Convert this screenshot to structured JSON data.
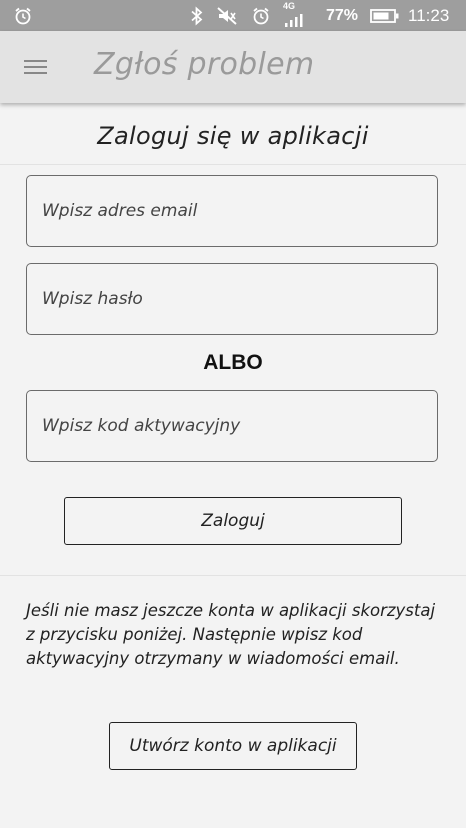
{
  "status_bar": {
    "icons": [
      "alarm-icon",
      "bluetooth-icon",
      "vibrate-off-icon",
      "alarm-icon",
      "network-4g-signal-icon",
      "battery-icon"
    ],
    "network": "4G",
    "battery": "77%",
    "time": "11:23"
  },
  "toolbar": {
    "menu_icon": "hamburger-menu-icon",
    "title": "Zgłoś problem"
  },
  "login": {
    "heading": "Zaloguj się w aplikacji",
    "email_placeholder": "Wpisz adres email",
    "password_placeholder": "Wpisz hasło",
    "or_label": "ALBO",
    "activation_placeholder": "Wpisz kod aktywacyjny",
    "login_button": "Zaloguj"
  },
  "register": {
    "info_text": "Jeśli nie masz jeszcze konta w aplikacji skorzystaj z przycisku poniżej. Następnie wpisz kod aktywacyjny otrzymany w wiadomości email.",
    "create_account_button": "Utwórz konto w aplikacji"
  }
}
